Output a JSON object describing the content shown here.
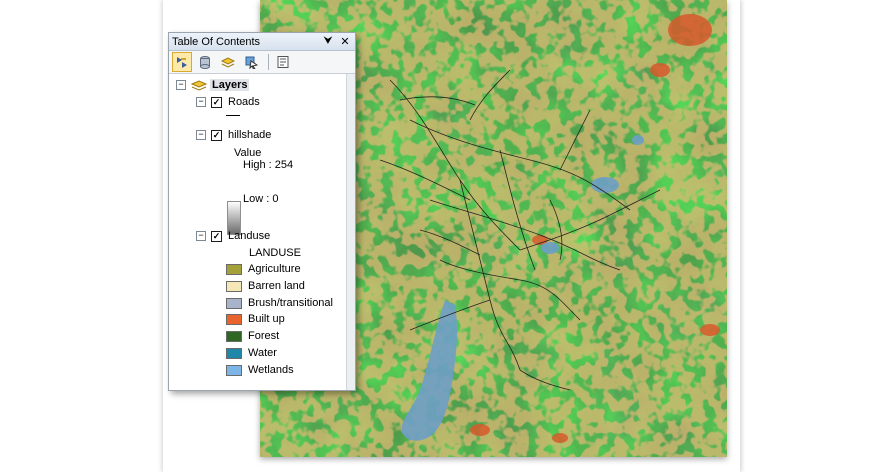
{
  "toc": {
    "title": "Table Of Contents",
    "pin_glyph": "⮟",
    "close_glyph": "✕",
    "toolbar_icons": [
      "list-by-drawing-order-icon",
      "list-by-source-icon",
      "list-by-visibility-icon",
      "list-by-selection-icon",
      "options-icon"
    ],
    "root": {
      "expander": "−",
      "label": "Layers"
    },
    "layers": {
      "roads": {
        "expander": "−",
        "checked": "✓",
        "label": "Roads"
      },
      "hillshade": {
        "expander": "−",
        "checked": "✓",
        "label": "hillshade",
        "legend_heading": "Value",
        "high": "High : 254",
        "low": "Low : 0"
      },
      "landuse": {
        "expander": "−",
        "checked": "✓",
        "label": "Landuse",
        "legend_heading": "LANDUSE",
        "classes": [
          {
            "label": "Agriculture",
            "color": "#a4a13a"
          },
          {
            "label": "Barren land",
            "color": "#f3e8b6"
          },
          {
            "label": "Brush/transitional",
            "color": "#a9b3c9"
          },
          {
            "label": "Built up",
            "color": "#e8642c"
          },
          {
            "label": "Forest",
            "color": "#2e6624"
          },
          {
            "label": "Water",
            "color": "#1f88a8"
          },
          {
            "label": "Wetlands",
            "color": "#7db6e6"
          }
        ]
      }
    }
  },
  "map": {
    "colors": {
      "forest": "#3f7a3a",
      "forest_dark": "#1f4a1c",
      "forest_light": "#7fb069",
      "agriculture": "#b59a3e",
      "built_up": "#d4552a",
      "water": "#6f9fc4",
      "roads": "#1a1a1a"
    }
  }
}
